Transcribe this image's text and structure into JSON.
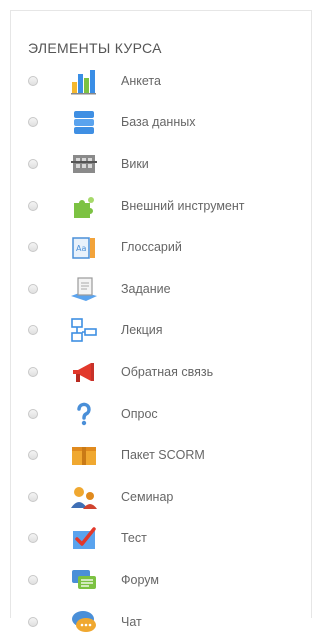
{
  "title": "ЭЛЕМЕНТЫ КУРСА",
  "items": [
    {
      "label": "Анкета",
      "icon": "survey-chart-icon"
    },
    {
      "label": "База данных",
      "icon": "database-icon"
    },
    {
      "label": "Вики",
      "icon": "wiki-icon"
    },
    {
      "label": "Внешний инструмент",
      "icon": "puzzle-icon"
    },
    {
      "label": "Глоссарий",
      "icon": "glossary-icon"
    },
    {
      "label": "Задание",
      "icon": "assignment-icon"
    },
    {
      "label": "Лекция",
      "icon": "lesson-icon"
    },
    {
      "label": "Обратная связь",
      "icon": "megaphone-icon"
    },
    {
      "label": "Опрос",
      "icon": "question-mark-icon"
    },
    {
      "label": "Пакет SCORM",
      "icon": "package-icon"
    },
    {
      "label": "Семинар",
      "icon": "workshop-icon"
    },
    {
      "label": "Тест",
      "icon": "quiz-check-icon"
    },
    {
      "label": "Форум",
      "icon": "forum-icon"
    },
    {
      "label": "Чат",
      "icon": "chat-icon"
    }
  ]
}
